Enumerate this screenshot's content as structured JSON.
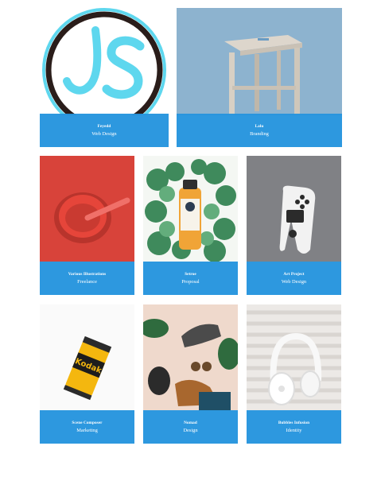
{
  "accent": "#2494de",
  "portfolio": {
    "items": [
      {
        "title": "Feyedd",
        "category": "Web Design",
        "image": "js-logo"
      },
      {
        "title": "Lalu",
        "category": "Branding",
        "image": "stool"
      },
      {
        "title": "Various Illustrations",
        "category": "Freelance",
        "image": "red-bowl"
      },
      {
        "title": "Setroe",
        "category": "Proposal",
        "image": "juice-bottle"
      },
      {
        "title": "Art Project",
        "category": "Web Design",
        "image": "game-controller"
      },
      {
        "title": "Scene Composer",
        "category": "Marketing",
        "image": "film-canister"
      },
      {
        "title": "Nomad",
        "category": "Design",
        "image": "travel-flatlay"
      },
      {
        "title": "Bubbles Infusion",
        "category": "Identity",
        "image": "headphones"
      }
    ]
  }
}
